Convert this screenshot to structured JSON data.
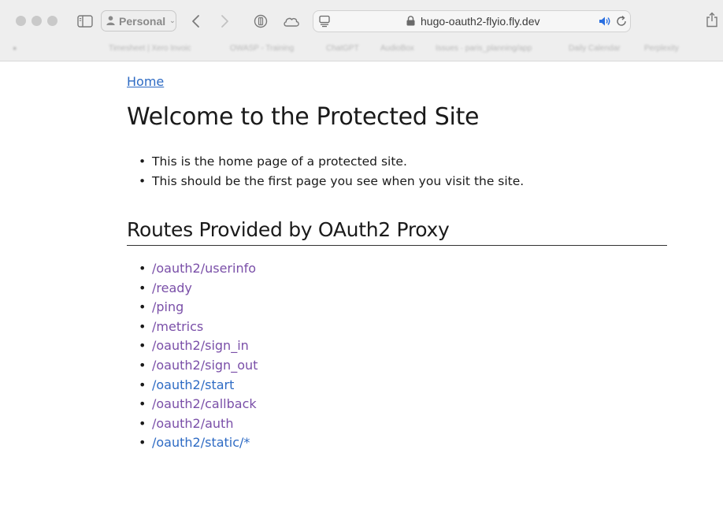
{
  "browser": {
    "profile": "Personal",
    "url": "hugo-oauth2-flyio.fly.dev",
    "bookmarks": [
      "Timesheet | Xero Invoic",
      "OWASP - Training",
      "ChatGPT",
      "AudioBox",
      "Issues · paris_planning/app",
      "Daily Calendar",
      "Perplexity"
    ]
  },
  "page": {
    "home_link": "Home",
    "title": "Welcome to the Protected Site",
    "intro": [
      "This is the home page of a protected site.",
      "This should be the first page you see when you visit the site."
    ],
    "routes_heading": "Routes Provided by OAuth2 Proxy",
    "routes": [
      {
        "label": "/oauth2/userinfo",
        "visited": true
      },
      {
        "label": "/ready",
        "visited": true
      },
      {
        "label": "/ping",
        "visited": true
      },
      {
        "label": "/metrics",
        "visited": true
      },
      {
        "label": "/oauth2/sign_in",
        "visited": true
      },
      {
        "label": "/oauth2/sign_out",
        "visited": true
      },
      {
        "label": "/oauth2/start",
        "visited": false
      },
      {
        "label": "/oauth2/callback",
        "visited": true
      },
      {
        "label": "/oauth2/auth",
        "visited": true
      },
      {
        "label": "/oauth2/static/*",
        "visited": false
      }
    ]
  },
  "colors": {
    "link": "#2e6bc4",
    "visited_link": "#7a4fa8",
    "audio_icon": "#2a6fe0"
  },
  "icons": [
    "sidebar-icon",
    "person-icon",
    "back-icon",
    "forward-icon",
    "privacy-icon",
    "icloud-icon",
    "tab-overview-icon",
    "lock-icon",
    "audio-icon",
    "reload-icon",
    "share-icon"
  ]
}
